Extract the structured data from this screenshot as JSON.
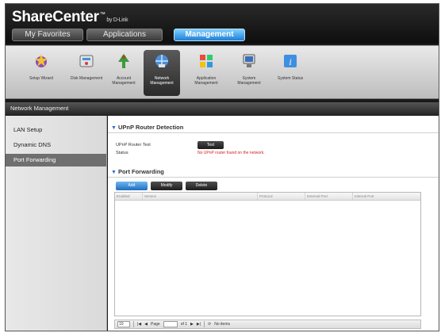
{
  "header": {
    "brand": "ShareCenter",
    "brand_tm": "™",
    "brand_by": "by D-Link",
    "tabs": [
      {
        "label": "My Favorites"
      },
      {
        "label": "Applications"
      },
      {
        "label": "Management"
      }
    ]
  },
  "toolbar": {
    "items": [
      {
        "label": "Setup Wizard",
        "icon": "wizard-icon"
      },
      {
        "label": "Disk Management",
        "icon": "disk-management-icon"
      },
      {
        "label": "Account Management",
        "icon": "account-management-icon"
      },
      {
        "label": "Network Management",
        "icon": "network-management-icon"
      },
      {
        "label": "Application Management",
        "icon": "application-management-icon"
      },
      {
        "label": "System Management",
        "icon": "system-management-icon"
      },
      {
        "label": "System Status",
        "icon": "system-status-icon"
      }
    ]
  },
  "section_title": "Network Management",
  "sidebar": {
    "items": [
      {
        "label": "LAN Setup"
      },
      {
        "label": "Dynamic DNS"
      },
      {
        "label": "Port Forwarding"
      }
    ]
  },
  "upnp": {
    "heading": "UPnP Router Detection",
    "test_label": "UPnP Router Test",
    "status_label": "Status",
    "test_button": "Test",
    "status_value": "No UPnP router found on the network."
  },
  "port_forwarding": {
    "heading": "Port Forwarding",
    "buttons": {
      "add": "Add",
      "modify": "Modify",
      "delete": "Delete"
    },
    "columns": [
      "Enabled",
      "Service",
      "Protocol",
      "External Port",
      "Internal Port"
    ],
    "pager": {
      "page_size": "10",
      "page_label": "Page",
      "of_label": "of 1",
      "no_items": "No items"
    }
  },
  "colors": {
    "accent": "#1e7fd6",
    "error": "#d42020"
  }
}
